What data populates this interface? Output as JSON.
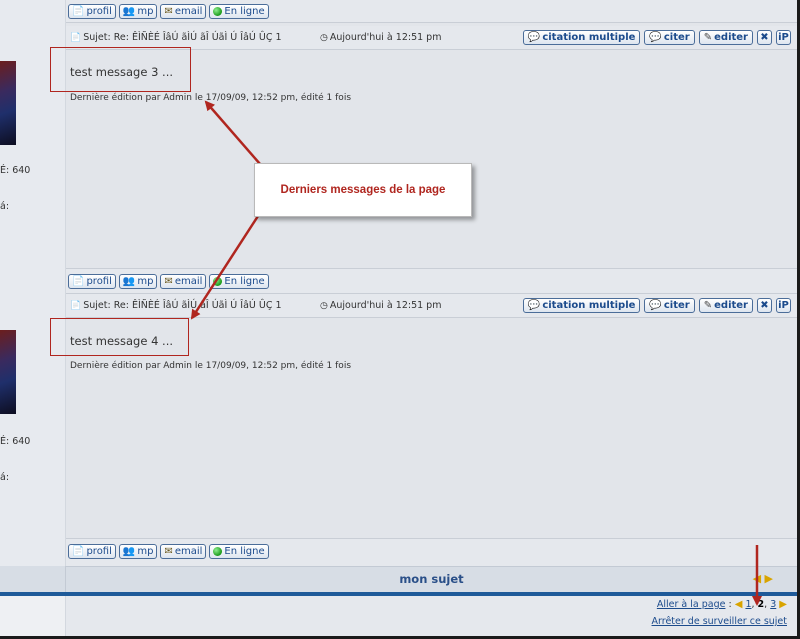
{
  "post_buttons": {
    "profile": "profil",
    "pm": "mp",
    "email": "email",
    "online": "En ligne"
  },
  "post_actions": {
    "multi_quote": "citation multiple",
    "quote": "citer",
    "edit": "editer",
    "delete": "✖",
    "ip": "iP"
  },
  "posts": [
    {
      "subject": "Sujet: Re: ÊÌÑÈÉ ÎâÚ ãÌÚ ãÎ ÚãÌ Ú ÎâÚ ÛÇ 1",
      "date": "Aujourd'hui à 12:51 pm",
      "message": "test message 3 ...",
      "edited": "Dernière édition par Admin le 17/09/09, 12:52 pm, édité 1 fois",
      "stat_1": "É: 640",
      "stat_2": "á:"
    },
    {
      "subject": "Sujet: Re: ÊÌÑÈÉ ÎâÚ ãÌÚ ãÎ ÚãÌ Ú ÎâÚ ÛÇ 1",
      "date": "Aujourd'hui à 12:51 pm",
      "message": "test message 4 ...",
      "edited": "Dernière édition par Admin le 17/09/09, 12:52 pm, édité 1 fois",
      "stat_1": "É: 640",
      "stat_2": "á:"
    }
  ],
  "annotation": {
    "callout_text": "Derniers messages de la page"
  },
  "footer": {
    "topic_title": "mon sujet",
    "goto_label": "Aller à la page",
    "goto_sep": ":",
    "pages": [
      "1",
      "2",
      "3"
    ],
    "current_page": "2",
    "stop_watching": "Arrêter de surveiller ce sujet"
  },
  "icons": {
    "profile": "profile-icon",
    "pm": "pm-icon",
    "email": "email-icon",
    "online": "online-status-icon",
    "subject": "post-icon",
    "date": "clock-icon",
    "arrow_left": "arrow-left-icon",
    "arrow_right": "arrow-right-icon"
  },
  "colors": {
    "accent": "#1c4b8c",
    "annotation": "#b0261f",
    "online": "#1a9a1a",
    "footer_bar": "#1e5a99"
  }
}
